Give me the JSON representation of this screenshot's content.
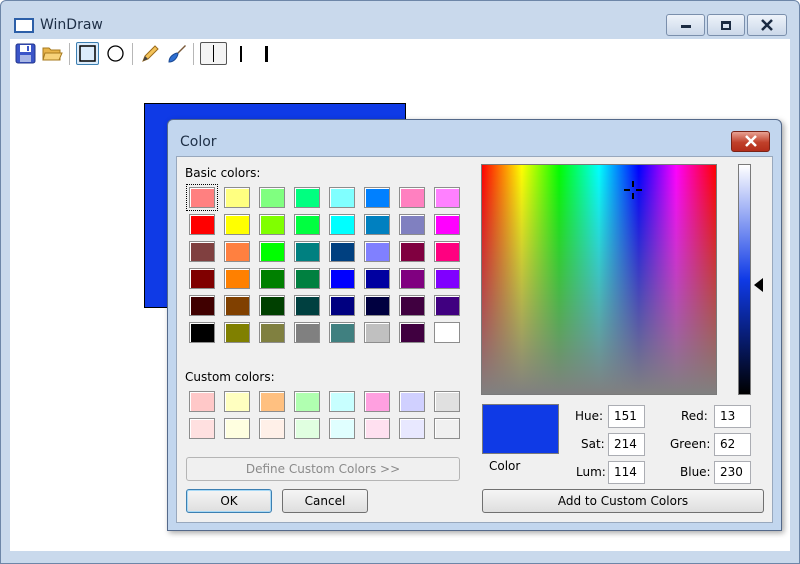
{
  "window": {
    "title": "WinDraw"
  },
  "dialog": {
    "title": "Color",
    "basic_label": "Basic colors:",
    "custom_label": "Custom colors:",
    "define_button": "Define Custom Colors >>",
    "ok_button": "OK",
    "cancel_button": "Cancel",
    "add_button": "Add to Custom Colors",
    "color_label": "Color",
    "hue_label": "Hue:",
    "hue_value": "151",
    "sat_label": "Sat:",
    "sat_value": "214",
    "lum_label": "Lum:",
    "lum_value": "114",
    "red_label": "Red:",
    "red_value": "13",
    "green_label": "Green:",
    "green_value": "62",
    "blue_label": "Blue:",
    "blue_value": "230",
    "selected_color": "#0F3AE6",
    "basic_colors": [
      "#ff8080",
      "#ffff80",
      "#80ff80",
      "#00ff80",
      "#80ffff",
      "#0080ff",
      "#ff80c0",
      "#ff80ff",
      "#ff0000",
      "#ffff00",
      "#80ff00",
      "#00ff40",
      "#00ffff",
      "#0080c0",
      "#8080c0",
      "#ff00ff",
      "#804040",
      "#ff8040",
      "#00ff00",
      "#008080",
      "#004080",
      "#8080ff",
      "#800040",
      "#ff0080",
      "#800000",
      "#ff8000",
      "#008000",
      "#008040",
      "#0000ff",
      "#0000a0",
      "#800080",
      "#8000ff",
      "#400000",
      "#804000",
      "#004000",
      "#004040",
      "#000080",
      "#000040",
      "#400040",
      "#400080",
      "#000000",
      "#808000",
      "#808040",
      "#808080",
      "#408080",
      "#c0c0c0",
      "#400040",
      "#ffffff"
    ],
    "custom_colors": [
      "#ffc8c8",
      "#ffffc0",
      "#ffc080",
      "#b0ffb0",
      "#c8ffff",
      "#ffa0e0",
      "#d0d0ff",
      "#e0e0e0",
      "#ffe0e0",
      "#ffffe0",
      "#fff0e8",
      "#e0ffe0",
      "#e0ffff",
      "#ffe0f0",
      "#e8e8ff",
      "#f0f0f0"
    ]
  },
  "colors": {
    "canvas_rect": "#0f3ae6"
  }
}
